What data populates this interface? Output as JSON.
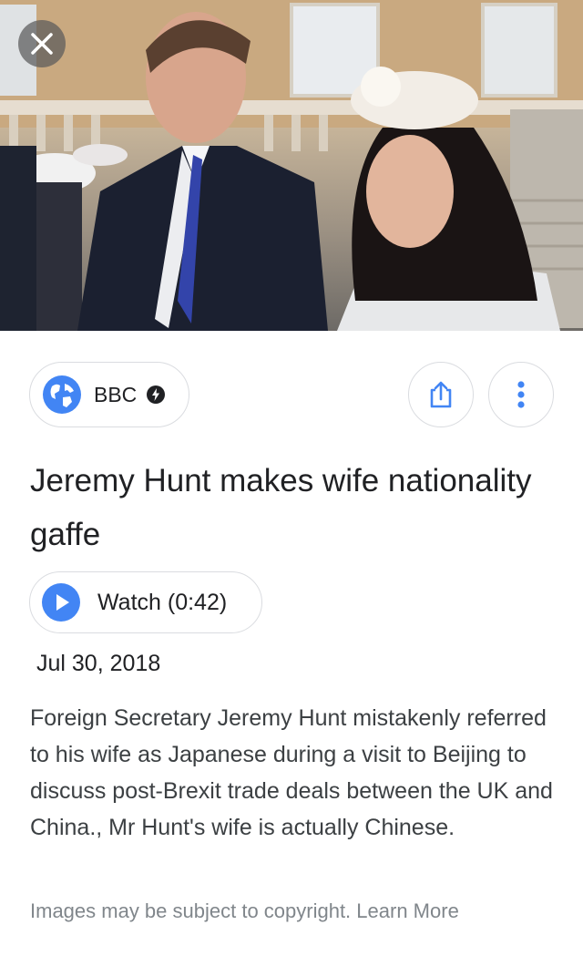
{
  "source": {
    "name": "BBC",
    "icon": "globe-icon",
    "badge_icon": "amp-lightning-icon"
  },
  "actions": {
    "share_icon": "share-icon",
    "more_icon": "more-vert-icon",
    "close_icon": "close-icon"
  },
  "article": {
    "title": "Jeremy Hunt makes wife nationality gaffe",
    "watch_label": "Watch (0:42)",
    "date": "Jul 30, 2018",
    "description": "Foreign Secretary Jeremy Hunt mistakenly referred to his wife as Japanese during a visit to Beijing to discuss post-Brexit trade deals between the UK and China., Mr Hunt's wife is actually Chinese."
  },
  "footer": {
    "copyright_text": "Images may be subject to copyright.",
    "learn_more": "Learn More"
  },
  "colors": {
    "accent_blue": "#4285f4",
    "chip_border": "#dadce0",
    "muted_text": "#80868b"
  }
}
